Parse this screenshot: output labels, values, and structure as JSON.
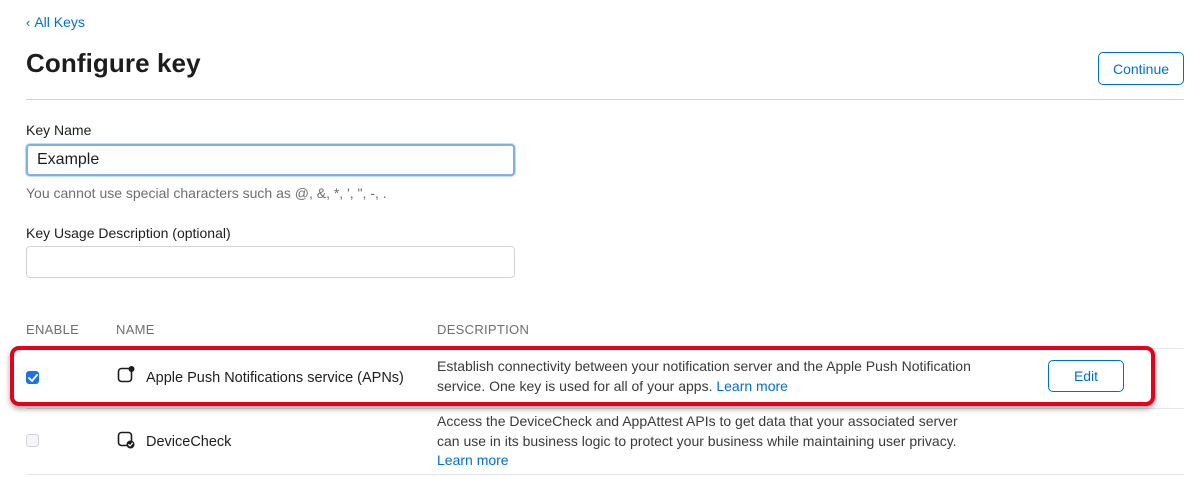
{
  "nav": {
    "back_label": "All Keys"
  },
  "header": {
    "title": "Configure key",
    "continue_label": "Continue"
  },
  "form": {
    "key_name_label": "Key Name",
    "key_name_value": "Example",
    "key_name_helper": "You cannot use special characters such as @, &, *, ', \", -, .",
    "description_label": "Key Usage Description (optional)",
    "description_value": ""
  },
  "table": {
    "columns": {
      "enable": "ENABLE",
      "name": "NAME",
      "description": "DESCRIPTION"
    },
    "rows": [
      {
        "enabled": true,
        "icon": "push-notification-icon",
        "name": "Apple Push Notifications service (APNs)",
        "description": "Establish connectivity between your notification server and the Apple Push Notification service. One key is used for all of your apps.",
        "learn_more": "Learn more",
        "action_label": "Edit"
      },
      {
        "enabled": false,
        "icon": "device-check-icon",
        "name": "DeviceCheck",
        "description": "Access the DeviceCheck and AppAttest APIs to get data that your associated server can use in its business logic to protect your business while maintaining user privacy.",
        "learn_more": "Learn more"
      }
    ]
  },
  "colors": {
    "accent": "#0070c9",
    "checkbox": "#1a73e8",
    "highlight": "#e5001b"
  }
}
